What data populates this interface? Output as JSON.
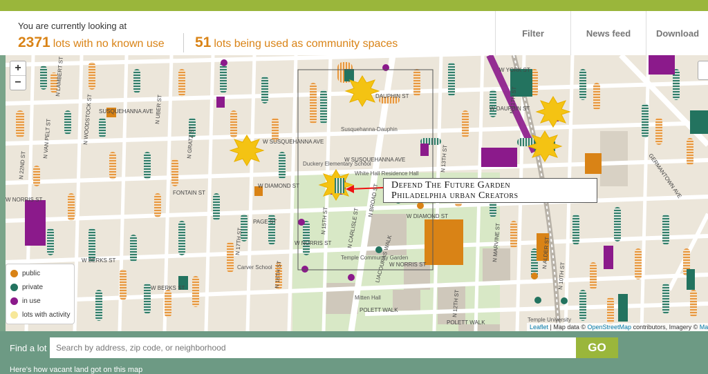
{
  "header": {
    "intro": "You are currently looking at",
    "stat1_count": "2371",
    "stat1_label": "lots with no known use",
    "stat2_count": "51",
    "stat2_label": "lots being used as community spaces",
    "buttons": {
      "filter": "Filter",
      "news": "News feed",
      "download": "Download"
    }
  },
  "map": {
    "zoom_in": "+",
    "zoom_out": "−",
    "streets": {
      "york": "W YORK ST",
      "dauphin_left": "DAUPHIN ST",
      "dauphin_right": "W DAUPHIN ST",
      "susq_left": "SUSQUEHANNA AVE",
      "susq_mid": "W SUSQUEHANNA AVE",
      "susq_mid2": "W SUSQUEHANNA AVE",
      "diamond_left": "W DIAMOND ST",
      "diamond_mid": "W DIAMOND ST",
      "norris_left": "W NORRIS ST",
      "norris_mid": "W NORRIS ST",
      "norris_right": "W NORRIS ST",
      "berks_left": "W BERKS ST",
      "berks_mid": "W BERKS ST",
      "polett": "POLETT WALK",
      "polett_right": "POLETT WALK",
      "liacouras": "LIACOURAS WALK",
      "broad": "N BROAD ST",
      "n13th": "N 13TH ST",
      "n15th": "N 15TH ST",
      "n16th": "N 16TH ST",
      "n17th": "N 17TH ST",
      "n22nd": "N 22ND ST",
      "n12th": "N 12TH ST",
      "n11th": "N 11TH ST",
      "n10th": "N 10TH ST",
      "carlisle": "N CARLISLE ST",
      "germantown": "GERMANTOWN AVE",
      "marvine": "N MARVINE ST",
      "alder": "N ALDER ST",
      "woodstock": "N WOODSTOCK ST",
      "lambert": "N LAMBERT ST",
      "uber": "N UBER ST",
      "graz": "N GRATZ ST",
      "fontain": "FONTAIN ST",
      "page": "PAGE ST",
      "vanpelt": "N VAN PELT ST"
    },
    "places": {
      "susq_dauphin": "Susquehanna-Dauphin",
      "duckery": "Duckery Elementary School",
      "whitehall": "White Hall Residence Hall",
      "temple_garden": "Temple Community Garden",
      "carver": "Carver School",
      "mitten": "Mitten Hall",
      "temple_univ": "Temple University"
    },
    "callout": {
      "line1": "Defend The Future Garden",
      "line2": "Philadelphia urban Creators"
    },
    "attribution": {
      "leaflet": "Leaflet",
      "text1": " | Map data © ",
      "osm": "OpenStreetMap",
      "text2": " contributors, Imagery © ",
      "map": "Map"
    }
  },
  "legend": {
    "items": [
      {
        "label": "public",
        "color": "#d98316"
      },
      {
        "label": "private",
        "color": "#23735f"
      },
      {
        "label": "in use",
        "color": "#8b1a8b"
      },
      {
        "label": "lots with activity",
        "color": "#f7e89a"
      }
    ]
  },
  "find": {
    "label": "Find a lot",
    "placeholder": "Search by address, zip code, or neighborhood",
    "go": "GO",
    "cut_text": "Here's how vacant land got on this map"
  },
  "colors": {
    "public": "#d98316",
    "private": "#23735f",
    "in_use": "#8b1a8b",
    "activity": "#f7e89a",
    "accent_green": "#9ab63b"
  }
}
